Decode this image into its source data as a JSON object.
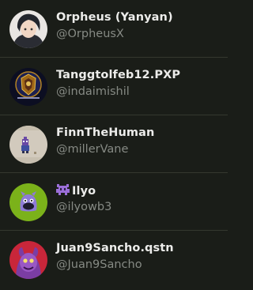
{
  "users": [
    {
      "name": "Orpheus (Yanyan)",
      "handle": "@OrpheusX",
      "avatar": "anime-portrait-avatar"
    },
    {
      "name": "Tanggtolfeb12.PXP",
      "handle": "@indaimishil",
      "avatar": "emblem-avatar"
    },
    {
      "name": "FinnTheHuman",
      "handle": "@millerVane",
      "avatar": "pixel-character-avatar"
    },
    {
      "name": "Ilyo",
      "handle": "@ilyowb3",
      "avatar": "purple-creature-avatar",
      "badge": "purple-alien-emoji"
    },
    {
      "name": "Juan9Sancho.qstn",
      "handle": "@Juan9Sancho",
      "avatar": "purple-monster-avatar"
    }
  ],
  "colors": {
    "background": "#1a1d18",
    "divider": "#34382f",
    "name_text": "#ececea",
    "handle_text": "#868a84"
  }
}
